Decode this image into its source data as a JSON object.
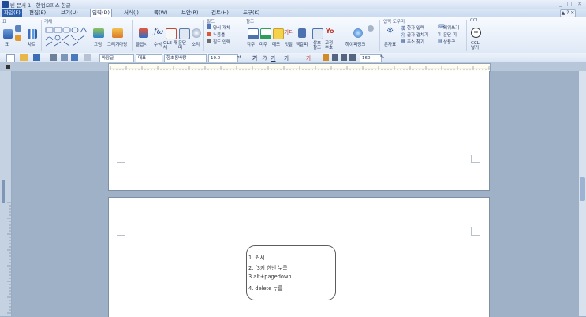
{
  "window": {
    "title": "빈 문서 1 - 한컴오피스 한글",
    "buttons": [
      "_",
      "□",
      "✕"
    ]
  },
  "menubar": {
    "items": [
      "파일(F)",
      "편집(E)",
      "보기(U)",
      "입력(D)",
      "서식(J)",
      "쪽(W)",
      "보안(R)",
      "검토(H)",
      "도구(K)"
    ],
    "active": "입력(D)",
    "right": "▲ ? ✕"
  },
  "ribbon": {
    "groups": [
      {
        "name": "표",
        "items": [
          "표",
          "차트"
        ]
      },
      {
        "name": "개체",
        "items": [
          "그림",
          "그리기마당"
        ]
      },
      {
        "name": "",
        "items": [
          "글맵시",
          "수식",
          "OLE 개체",
          "문단 띠",
          "소리"
        ]
      },
      {
        "name": "필드",
        "items": [
          "양식 개체",
          "누름틀",
          "필드 입력"
        ]
      },
      {
        "name": "참조",
        "items": [
          "각주",
          "미주",
          "메모",
          "덧말",
          "책갈피",
          "상호 참조",
          "교정 부호"
        ]
      },
      {
        "name": "",
        "items": [
          "하이퍼링크"
        ]
      },
      {
        "name": "입력 도우미",
        "items": [
          "문자표",
          "한자 입력",
          "글자 겹치기",
          "주소 찾기",
          "외워쓰기",
          "문단 띠",
          "상용구"
        ]
      },
      {
        "name": "CCL",
        "items": [
          "CCL 넣기"
        ]
      }
    ]
  },
  "toolbar2": {
    "style": "바탕글",
    "lang": "대표",
    "font": "함초롬바탕",
    "size": "10.0",
    "unit": "pt",
    "bold": "가",
    "italic": "가",
    "underline": "가",
    "strike": "가",
    "color": "가",
    "zoom": "160",
    "percent": "%"
  },
  "memo": {
    "lines": [
      "1. 커서",
      "2. f3키 한번 누름",
      "3.alt+pagedown",
      "4. delete 누름"
    ]
  }
}
